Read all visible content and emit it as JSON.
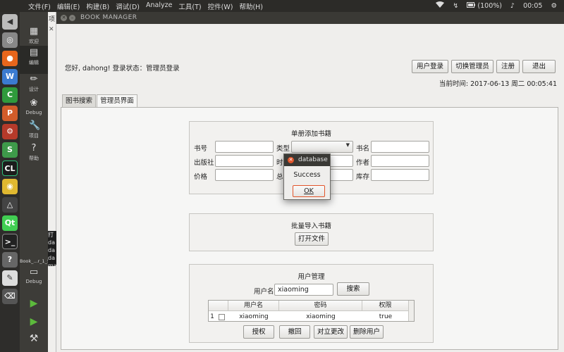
{
  "menubar": {
    "items": [
      "文件(F)",
      "编辑(E)",
      "构建(B)",
      "调试(D)",
      "Analyze",
      "工具(T)",
      "控件(W)",
      "帮助(H)"
    ],
    "battery": "(100%)",
    "clock": "00:05"
  },
  "qt": {
    "modes": [
      "欢迎",
      "编辑",
      "设计",
      "Debug",
      "项目",
      "帮助"
    ],
    "project_name": "Book_...r_1_5",
    "kit_label": "Debug",
    "panel_label": "项",
    "output_lines": [
      "打",
      "da",
      "da",
      "da",
      "ma"
    ]
  },
  "window": {
    "title": "BOOK MANAGER"
  },
  "header": {
    "greeting": "您好, dahong! 登录状态：管理员登录",
    "buttons": {
      "user_login": "用户登录",
      "switch_admin": "切换管理员",
      "register": "注册",
      "exit": "退出"
    },
    "current_time": "当前时间: 2017-06-13 周二 00:05:41"
  },
  "tabs": [
    "图书搜索",
    "管理员界面"
  ],
  "add_book": {
    "title": "单册添加书籍",
    "labels": {
      "isbn": "书号",
      "type": "类型",
      "name": "书名",
      "publisher": "出版社",
      "time": "时",
      "author": "作者",
      "price": "价格",
      "total": "总",
      "stock": "库存"
    }
  },
  "batch_import": {
    "title": "批量导入书籍",
    "open_file": "打开文件"
  },
  "user_mgmt": {
    "title": "用户管理",
    "username_label": "用户名",
    "username_value": "xiaoming",
    "search": "搜索",
    "columns": [
      "用户名",
      "密码",
      "权限"
    ],
    "rows": [
      {
        "index": "1",
        "username": "xiaoming",
        "password": "xiaoming",
        "permission": "true"
      }
    ],
    "actions": {
      "grant": "授权",
      "revoke": "撤回",
      "apply": "对立更改",
      "delete": "删除用户"
    }
  },
  "dialog": {
    "title": "database",
    "message": "Success",
    "ok": "OK"
  }
}
